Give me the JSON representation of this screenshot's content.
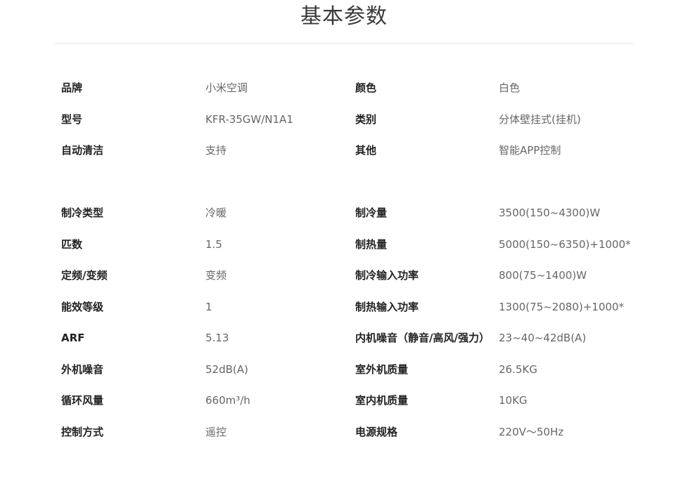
{
  "title": "基本参数",
  "sections": [
    {
      "rows": [
        {
          "label1": "品牌",
          "value1": "小米空调",
          "label2": "颜色",
          "value2": "白色"
        },
        {
          "label1": "型号",
          "value1": "KFR-35GW/N1A1",
          "label2": "类别",
          "value2": "分体壁挂式(挂机)"
        },
        {
          "label1": "自动清洁",
          "value1": "支持",
          "label2": "其他",
          "value2": "智能APP控制"
        }
      ]
    },
    {
      "rows": [
        {
          "label1": "制冷类型",
          "value1": "冷暖",
          "label2": "制冷量",
          "value2": "3500(150~4300)W"
        },
        {
          "label1": "匹数",
          "value1": "1.5",
          "label2": "制热量",
          "value2": "5000(150~6350)+1000*"
        },
        {
          "label1": "定频/变频",
          "value1": "变频",
          "label2": "制冷输入功率",
          "value2": "800(75~1400)W"
        },
        {
          "label1": "能效等级",
          "value1": "1",
          "label2": "制热输入功率",
          "value2": "1300(75~2080)+1000*"
        },
        {
          "label1": "ARF",
          "value1": "5.13",
          "label2": "内机噪音（静音/高风/强力）",
          "value2": "23~40~42dB(A)"
        },
        {
          "label1": "外机噪音",
          "value1": "52dB(A)",
          "label2": "室外机质量",
          "value2": "26.5KG"
        },
        {
          "label1": "循环风量",
          "value1": "660m³/h",
          "label2": "室内机质量",
          "value2": "10KG"
        },
        {
          "label1": "控制方式",
          "value1": "遥控",
          "label2": "电源规格",
          "value2": "220V～50Hz"
        }
      ]
    }
  ]
}
